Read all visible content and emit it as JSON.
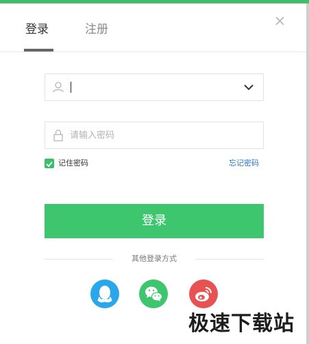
{
  "tabs": [
    {
      "label": "登录",
      "active": true
    },
    {
      "label": "注册",
      "active": false
    }
  ],
  "username": {
    "value": "",
    "placeholder": ""
  },
  "password": {
    "value": "",
    "placeholder": "请输入密码"
  },
  "remember": {
    "label": "记住密码",
    "checked": true
  },
  "forgot_label": "忘记密码",
  "login_button": "登录",
  "other_methods_label": "其他登录方式",
  "social": [
    {
      "name": "qq-icon",
      "color": "#2aa7ea"
    },
    {
      "name": "wechat-icon",
      "color": "#3ec66f"
    },
    {
      "name": "weibo-icon",
      "color": "#e85253"
    }
  ],
  "watermark": "极速下载站",
  "colors": {
    "accent": "#3dbf6a",
    "link": "#2a73c5"
  }
}
